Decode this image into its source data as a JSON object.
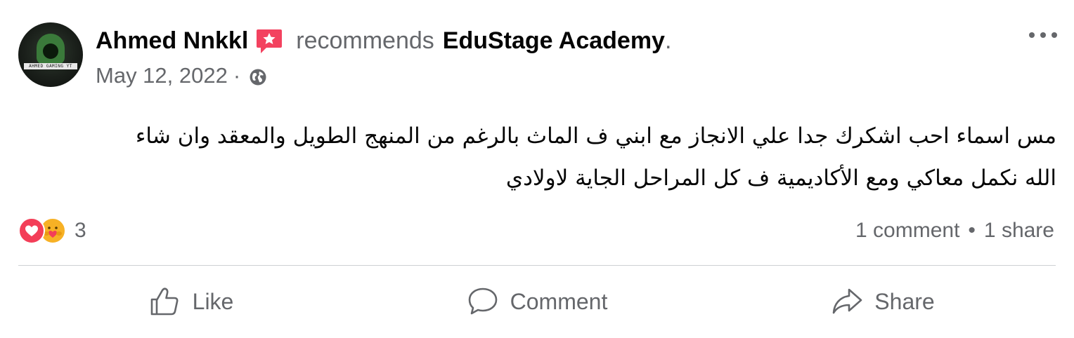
{
  "post": {
    "author": "Ahmed Nnkkl",
    "action_text": "recommends",
    "page_name": "EduStage Academy",
    "trailing": ".",
    "date": "May 12, 2022",
    "meta_separator": "·",
    "audience_icon": "globe-icon",
    "recommend_badge_icon": "recommendation-star-icon",
    "avatar_banner": "AHMED GAMING YT",
    "body_lines": [
      "مس اسماء احب اشكرك جدا علي الانجاز مع ابني ف الماث بالرغم من المنهج الطويل والمعقد وان شاء",
      "الله نكمل معاكي ومع الأكاديمية ف كل المراحل الجاية لاولادي"
    ]
  },
  "reactions": {
    "types": [
      "love",
      "care"
    ],
    "count": "3"
  },
  "engagement": {
    "comments": "1 comment",
    "separator": "•",
    "shares": "1 share"
  },
  "actions": {
    "like": "Like",
    "comment": "Comment",
    "share": "Share"
  },
  "colors": {
    "text_primary": "#050505",
    "text_secondary": "#65676b",
    "badge": "#f3425f",
    "love": "#f33e58",
    "care": "#f7b125",
    "divider": "#ced0d4"
  }
}
